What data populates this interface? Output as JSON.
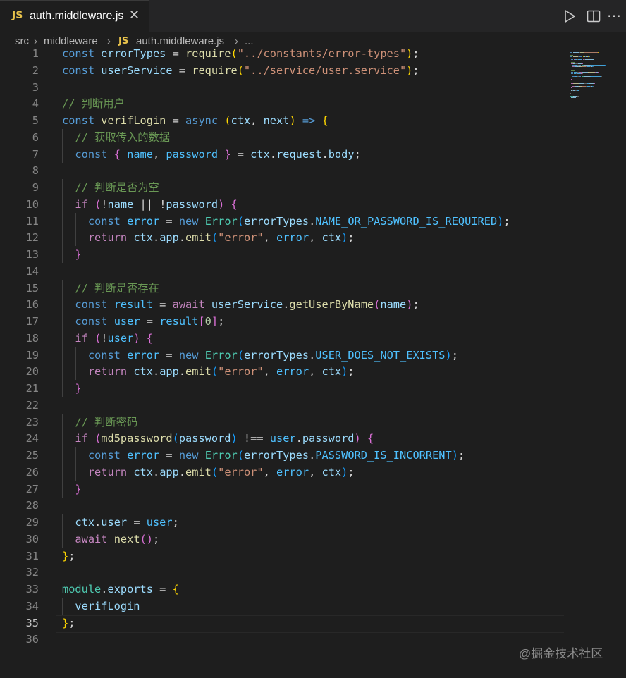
{
  "tab": {
    "badge": "JS",
    "filename": "auth.middleware.js",
    "close_glyph": "✕"
  },
  "toolbar": {
    "run_icon": "run-icon",
    "split_icon": "split-editor-icon",
    "more_glyph": "⋯"
  },
  "breadcrumb": {
    "segments": [
      "src",
      "middleware",
      "auth.middleware.js",
      "..."
    ],
    "file_badge": "JS",
    "separator": "›"
  },
  "editor": {
    "active_line": 35,
    "lines": [
      {
        "n": "1",
        "tokens": [
          [
            "const",
            "kw"
          ],
          [
            " ",
            "p"
          ],
          [
            "errorTypes",
            "var"
          ],
          [
            " = ",
            "p"
          ],
          [
            "require",
            "fn"
          ],
          [
            "(",
            "b1"
          ],
          [
            "\"../constants/error-types\"",
            "str"
          ],
          [
            ")",
            "b1"
          ],
          [
            ";",
            "p"
          ]
        ]
      },
      {
        "n": "2",
        "tokens": [
          [
            "const",
            "kw"
          ],
          [
            " ",
            "p"
          ],
          [
            "userService",
            "var"
          ],
          [
            " = ",
            "p"
          ],
          [
            "require",
            "fn"
          ],
          [
            "(",
            "b1"
          ],
          [
            "\"../service/user.service\"",
            "str"
          ],
          [
            ")",
            "b1"
          ],
          [
            ";",
            "p"
          ]
        ]
      },
      {
        "n": "3",
        "tokens": []
      },
      {
        "n": "4",
        "tokens": [
          [
            "// 判断用户",
            "cm"
          ]
        ]
      },
      {
        "n": "5",
        "tokens": [
          [
            "const",
            "kw"
          ],
          [
            " ",
            "p"
          ],
          [
            "verifLogin",
            "fn"
          ],
          [
            " = ",
            "p"
          ],
          [
            "async",
            "kw"
          ],
          [
            " ",
            "p"
          ],
          [
            "(",
            "b1"
          ],
          [
            "ctx",
            "var"
          ],
          [
            ", ",
            "p"
          ],
          [
            "next",
            "var"
          ],
          [
            ")",
            "b1"
          ],
          [
            " ",
            "p"
          ],
          [
            "=>",
            "kw"
          ],
          [
            " ",
            "p"
          ],
          [
            "{",
            "b1"
          ]
        ]
      },
      {
        "n": "6",
        "tokens": [
          [
            "  ",
            "p"
          ],
          [
            "// 获取传入的数据",
            "cm"
          ]
        ]
      },
      {
        "n": "7",
        "tokens": [
          [
            "  ",
            "p"
          ],
          [
            "const",
            "kw"
          ],
          [
            " ",
            "p"
          ],
          [
            "{",
            "b2"
          ],
          [
            " ",
            "p"
          ],
          [
            "name",
            "const"
          ],
          [
            ", ",
            "p"
          ],
          [
            "password",
            "const"
          ],
          [
            " ",
            "p"
          ],
          [
            "}",
            "b2"
          ],
          [
            " = ",
            "p"
          ],
          [
            "ctx",
            "var"
          ],
          [
            ".",
            "p"
          ],
          [
            "request",
            "var"
          ],
          [
            ".",
            "p"
          ],
          [
            "body",
            "var"
          ],
          [
            ";",
            "p"
          ]
        ]
      },
      {
        "n": "8",
        "tokens": []
      },
      {
        "n": "9",
        "tokens": [
          [
            "  ",
            "p"
          ],
          [
            "// 判断是否为空",
            "cm"
          ]
        ]
      },
      {
        "n": "10",
        "tokens": [
          [
            "  ",
            "p"
          ],
          [
            "if",
            "ctl"
          ],
          [
            " ",
            "p"
          ],
          [
            "(",
            "b2"
          ],
          [
            "!",
            "p"
          ],
          [
            "name",
            "var"
          ],
          [
            " || ",
            "p"
          ],
          [
            "!",
            "p"
          ],
          [
            "password",
            "var"
          ],
          [
            ")",
            "b2"
          ],
          [
            " ",
            "p"
          ],
          [
            "{",
            "b2"
          ]
        ]
      },
      {
        "n": "11",
        "tokens": [
          [
            "    ",
            "p"
          ],
          [
            "const",
            "kw"
          ],
          [
            " ",
            "p"
          ],
          [
            "error",
            "const"
          ],
          [
            " = ",
            "p"
          ],
          [
            "new",
            "kw"
          ],
          [
            " ",
            "p"
          ],
          [
            "Error",
            "cls"
          ],
          [
            "(",
            "b3"
          ],
          [
            "errorTypes",
            "var"
          ],
          [
            ".",
            "p"
          ],
          [
            "NAME_OR_PASSWORD_IS_REQUIRED",
            "const"
          ],
          [
            ")",
            "b3"
          ],
          [
            ";",
            "p"
          ]
        ]
      },
      {
        "n": "12",
        "tokens": [
          [
            "    ",
            "p"
          ],
          [
            "return",
            "ctl"
          ],
          [
            " ",
            "p"
          ],
          [
            "ctx",
            "var"
          ],
          [
            ".",
            "p"
          ],
          [
            "app",
            "var"
          ],
          [
            ".",
            "p"
          ],
          [
            "emit",
            "fn"
          ],
          [
            "(",
            "b3"
          ],
          [
            "\"error\"",
            "str"
          ],
          [
            ", ",
            "p"
          ],
          [
            "error",
            "const"
          ],
          [
            ", ",
            "p"
          ],
          [
            "ctx",
            "var"
          ],
          [
            ")",
            "b3"
          ],
          [
            ";",
            "p"
          ]
        ]
      },
      {
        "n": "13",
        "tokens": [
          [
            "  ",
            "p"
          ],
          [
            "}",
            "b2"
          ]
        ]
      },
      {
        "n": "14",
        "tokens": []
      },
      {
        "n": "15",
        "tokens": [
          [
            "  ",
            "p"
          ],
          [
            "// 判断是否存在",
            "cm"
          ]
        ]
      },
      {
        "n": "16",
        "tokens": [
          [
            "  ",
            "p"
          ],
          [
            "const",
            "kw"
          ],
          [
            " ",
            "p"
          ],
          [
            "result",
            "const"
          ],
          [
            " = ",
            "p"
          ],
          [
            "await",
            "ctl"
          ],
          [
            " ",
            "p"
          ],
          [
            "userService",
            "var"
          ],
          [
            ".",
            "p"
          ],
          [
            "getUserByName",
            "fn"
          ],
          [
            "(",
            "b2"
          ],
          [
            "name",
            "var"
          ],
          [
            ")",
            "b2"
          ],
          [
            ";",
            "p"
          ]
        ]
      },
      {
        "n": "17",
        "tokens": [
          [
            "  ",
            "p"
          ],
          [
            "const",
            "kw"
          ],
          [
            " ",
            "p"
          ],
          [
            "user",
            "const"
          ],
          [
            " = ",
            "p"
          ],
          [
            "result",
            "const"
          ],
          [
            "[",
            "b2"
          ],
          [
            "0",
            "num"
          ],
          [
            "]",
            "b2"
          ],
          [
            ";",
            "p"
          ]
        ]
      },
      {
        "n": "18",
        "tokens": [
          [
            "  ",
            "p"
          ],
          [
            "if",
            "ctl"
          ],
          [
            " ",
            "p"
          ],
          [
            "(",
            "b2"
          ],
          [
            "!",
            "p"
          ],
          [
            "user",
            "const"
          ],
          [
            ")",
            "b2"
          ],
          [
            " ",
            "p"
          ],
          [
            "{",
            "b2"
          ]
        ]
      },
      {
        "n": "19",
        "tokens": [
          [
            "    ",
            "p"
          ],
          [
            "const",
            "kw"
          ],
          [
            " ",
            "p"
          ],
          [
            "error",
            "const"
          ],
          [
            " = ",
            "p"
          ],
          [
            "new",
            "kw"
          ],
          [
            " ",
            "p"
          ],
          [
            "Error",
            "cls"
          ],
          [
            "(",
            "b3"
          ],
          [
            "errorTypes",
            "var"
          ],
          [
            ".",
            "p"
          ],
          [
            "USER_DOES_NOT_EXISTS",
            "const"
          ],
          [
            ")",
            "b3"
          ],
          [
            ";",
            "p"
          ]
        ]
      },
      {
        "n": "20",
        "tokens": [
          [
            "    ",
            "p"
          ],
          [
            "return",
            "ctl"
          ],
          [
            " ",
            "p"
          ],
          [
            "ctx",
            "var"
          ],
          [
            ".",
            "p"
          ],
          [
            "app",
            "var"
          ],
          [
            ".",
            "p"
          ],
          [
            "emit",
            "fn"
          ],
          [
            "(",
            "b3"
          ],
          [
            "\"error\"",
            "str"
          ],
          [
            ", ",
            "p"
          ],
          [
            "error",
            "const"
          ],
          [
            ", ",
            "p"
          ],
          [
            "ctx",
            "var"
          ],
          [
            ")",
            "b3"
          ],
          [
            ";",
            "p"
          ]
        ]
      },
      {
        "n": "21",
        "tokens": [
          [
            "  ",
            "p"
          ],
          [
            "}",
            "b2"
          ]
        ]
      },
      {
        "n": "22",
        "tokens": []
      },
      {
        "n": "23",
        "tokens": [
          [
            "  ",
            "p"
          ],
          [
            "// 判断密码",
            "cm"
          ]
        ]
      },
      {
        "n": "24",
        "tokens": [
          [
            "  ",
            "p"
          ],
          [
            "if",
            "ctl"
          ],
          [
            " ",
            "p"
          ],
          [
            "(",
            "b2"
          ],
          [
            "md5password",
            "fn"
          ],
          [
            "(",
            "b3"
          ],
          [
            "password",
            "var"
          ],
          [
            ")",
            "b3"
          ],
          [
            " !== ",
            "p"
          ],
          [
            "user",
            "const"
          ],
          [
            ".",
            "p"
          ],
          [
            "password",
            "var"
          ],
          [
            ")",
            "b2"
          ],
          [
            " ",
            "p"
          ],
          [
            "{",
            "b2"
          ]
        ]
      },
      {
        "n": "25",
        "tokens": [
          [
            "    ",
            "p"
          ],
          [
            "const",
            "kw"
          ],
          [
            " ",
            "p"
          ],
          [
            "error",
            "const"
          ],
          [
            " = ",
            "p"
          ],
          [
            "new",
            "kw"
          ],
          [
            " ",
            "p"
          ],
          [
            "Error",
            "cls"
          ],
          [
            "(",
            "b3"
          ],
          [
            "errorTypes",
            "var"
          ],
          [
            ".",
            "p"
          ],
          [
            "PASSWORD_IS_INCORRENT",
            "const"
          ],
          [
            ")",
            "b3"
          ],
          [
            ";",
            "p"
          ]
        ]
      },
      {
        "n": "26",
        "tokens": [
          [
            "    ",
            "p"
          ],
          [
            "return",
            "ctl"
          ],
          [
            " ",
            "p"
          ],
          [
            "ctx",
            "var"
          ],
          [
            ".",
            "p"
          ],
          [
            "app",
            "var"
          ],
          [
            ".",
            "p"
          ],
          [
            "emit",
            "fn"
          ],
          [
            "(",
            "b3"
          ],
          [
            "\"error\"",
            "str"
          ],
          [
            ", ",
            "p"
          ],
          [
            "error",
            "const"
          ],
          [
            ", ",
            "p"
          ],
          [
            "ctx",
            "var"
          ],
          [
            ")",
            "b3"
          ],
          [
            ";",
            "p"
          ]
        ]
      },
      {
        "n": "27",
        "tokens": [
          [
            "  ",
            "p"
          ],
          [
            "}",
            "b2"
          ]
        ]
      },
      {
        "n": "28",
        "tokens": []
      },
      {
        "n": "29",
        "tokens": [
          [
            "  ",
            "p"
          ],
          [
            "ctx",
            "var"
          ],
          [
            ".",
            "p"
          ],
          [
            "user",
            "var"
          ],
          [
            " = ",
            "p"
          ],
          [
            "user",
            "const"
          ],
          [
            ";",
            "p"
          ]
        ]
      },
      {
        "n": "30",
        "tokens": [
          [
            "  ",
            "p"
          ],
          [
            "await",
            "ctl"
          ],
          [
            " ",
            "p"
          ],
          [
            "next",
            "fn"
          ],
          [
            "(",
            "b2"
          ],
          [
            ")",
            "b2"
          ],
          [
            ";",
            "p"
          ]
        ]
      },
      {
        "n": "31",
        "tokens": [
          [
            "}",
            "b1"
          ],
          [
            ";",
            "p"
          ]
        ]
      },
      {
        "n": "32",
        "tokens": []
      },
      {
        "n": "33",
        "tokens": [
          [
            "module",
            "cls"
          ],
          [
            ".",
            "p"
          ],
          [
            "exports",
            "var"
          ],
          [
            " = ",
            "p"
          ],
          [
            "{",
            "b1"
          ]
        ]
      },
      {
        "n": "34",
        "tokens": [
          [
            "  ",
            "p"
          ],
          [
            "verifLogin",
            "var"
          ]
        ]
      },
      {
        "n": "35",
        "tokens": [
          [
            "}",
            "b1"
          ],
          [
            ";",
            "p"
          ]
        ]
      },
      {
        "n": "36",
        "tokens": []
      }
    ]
  },
  "watermark": "@掘金技术社区",
  "colors": {
    "background": "#1e1e1e",
    "tabbar": "#252526",
    "keyword": "#569cd6",
    "control": "#c586c0",
    "variable": "#9cdcfe",
    "constant": "#4fc1ff",
    "function": "#dcdcaa",
    "string": "#ce9178",
    "comment": "#6a9955",
    "class": "#4ec9b0",
    "number": "#b5cea8",
    "bracket1": "#ffd700",
    "bracket2": "#da70d6",
    "bracket3": "#179fff",
    "js_badge": "#e8c24b"
  }
}
